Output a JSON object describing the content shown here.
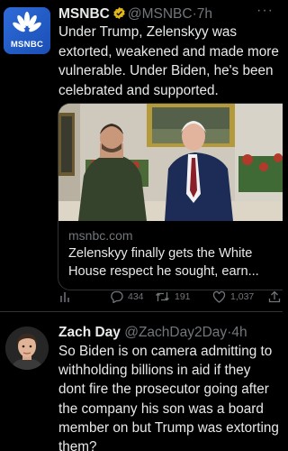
{
  "tweet1": {
    "author_name": "MSNBC",
    "author_handle": "@MSNBC",
    "time": "7h",
    "avatar_label": "MSNBC",
    "text": "Under Trump, Zelenskyy was extorted, weakened and made more vulnerable. Under Biden, he's been celebrated and supported.",
    "card": {
      "domain": "msnbc.com",
      "title": "Zelenskyy finally gets the White House respect he sought, earn..."
    },
    "actions": {
      "replies": "434",
      "retweets": "191",
      "likes": "1,037"
    }
  },
  "tweet2": {
    "author_name": "Zach Day",
    "author_handle": "@ZachDay2Day",
    "time": "4h",
    "text": "So Biden is on camera admitting to withholding billions in aid if they dont fire the prosecutor going after the company his son was a board member on but Trump was extorting them?"
  },
  "colors": {
    "background": "#000000",
    "text_primary": "#e7e9ea",
    "text_secondary": "#71767b",
    "verified_badge": "#e2b719",
    "msnbc_blue": "#2f6bd8"
  },
  "icons": [
    "msnbc-peacock-icon",
    "verified-badge-icon",
    "more-icon",
    "analytics-icon",
    "reply-icon",
    "retweet-icon",
    "like-icon",
    "share-icon"
  ]
}
